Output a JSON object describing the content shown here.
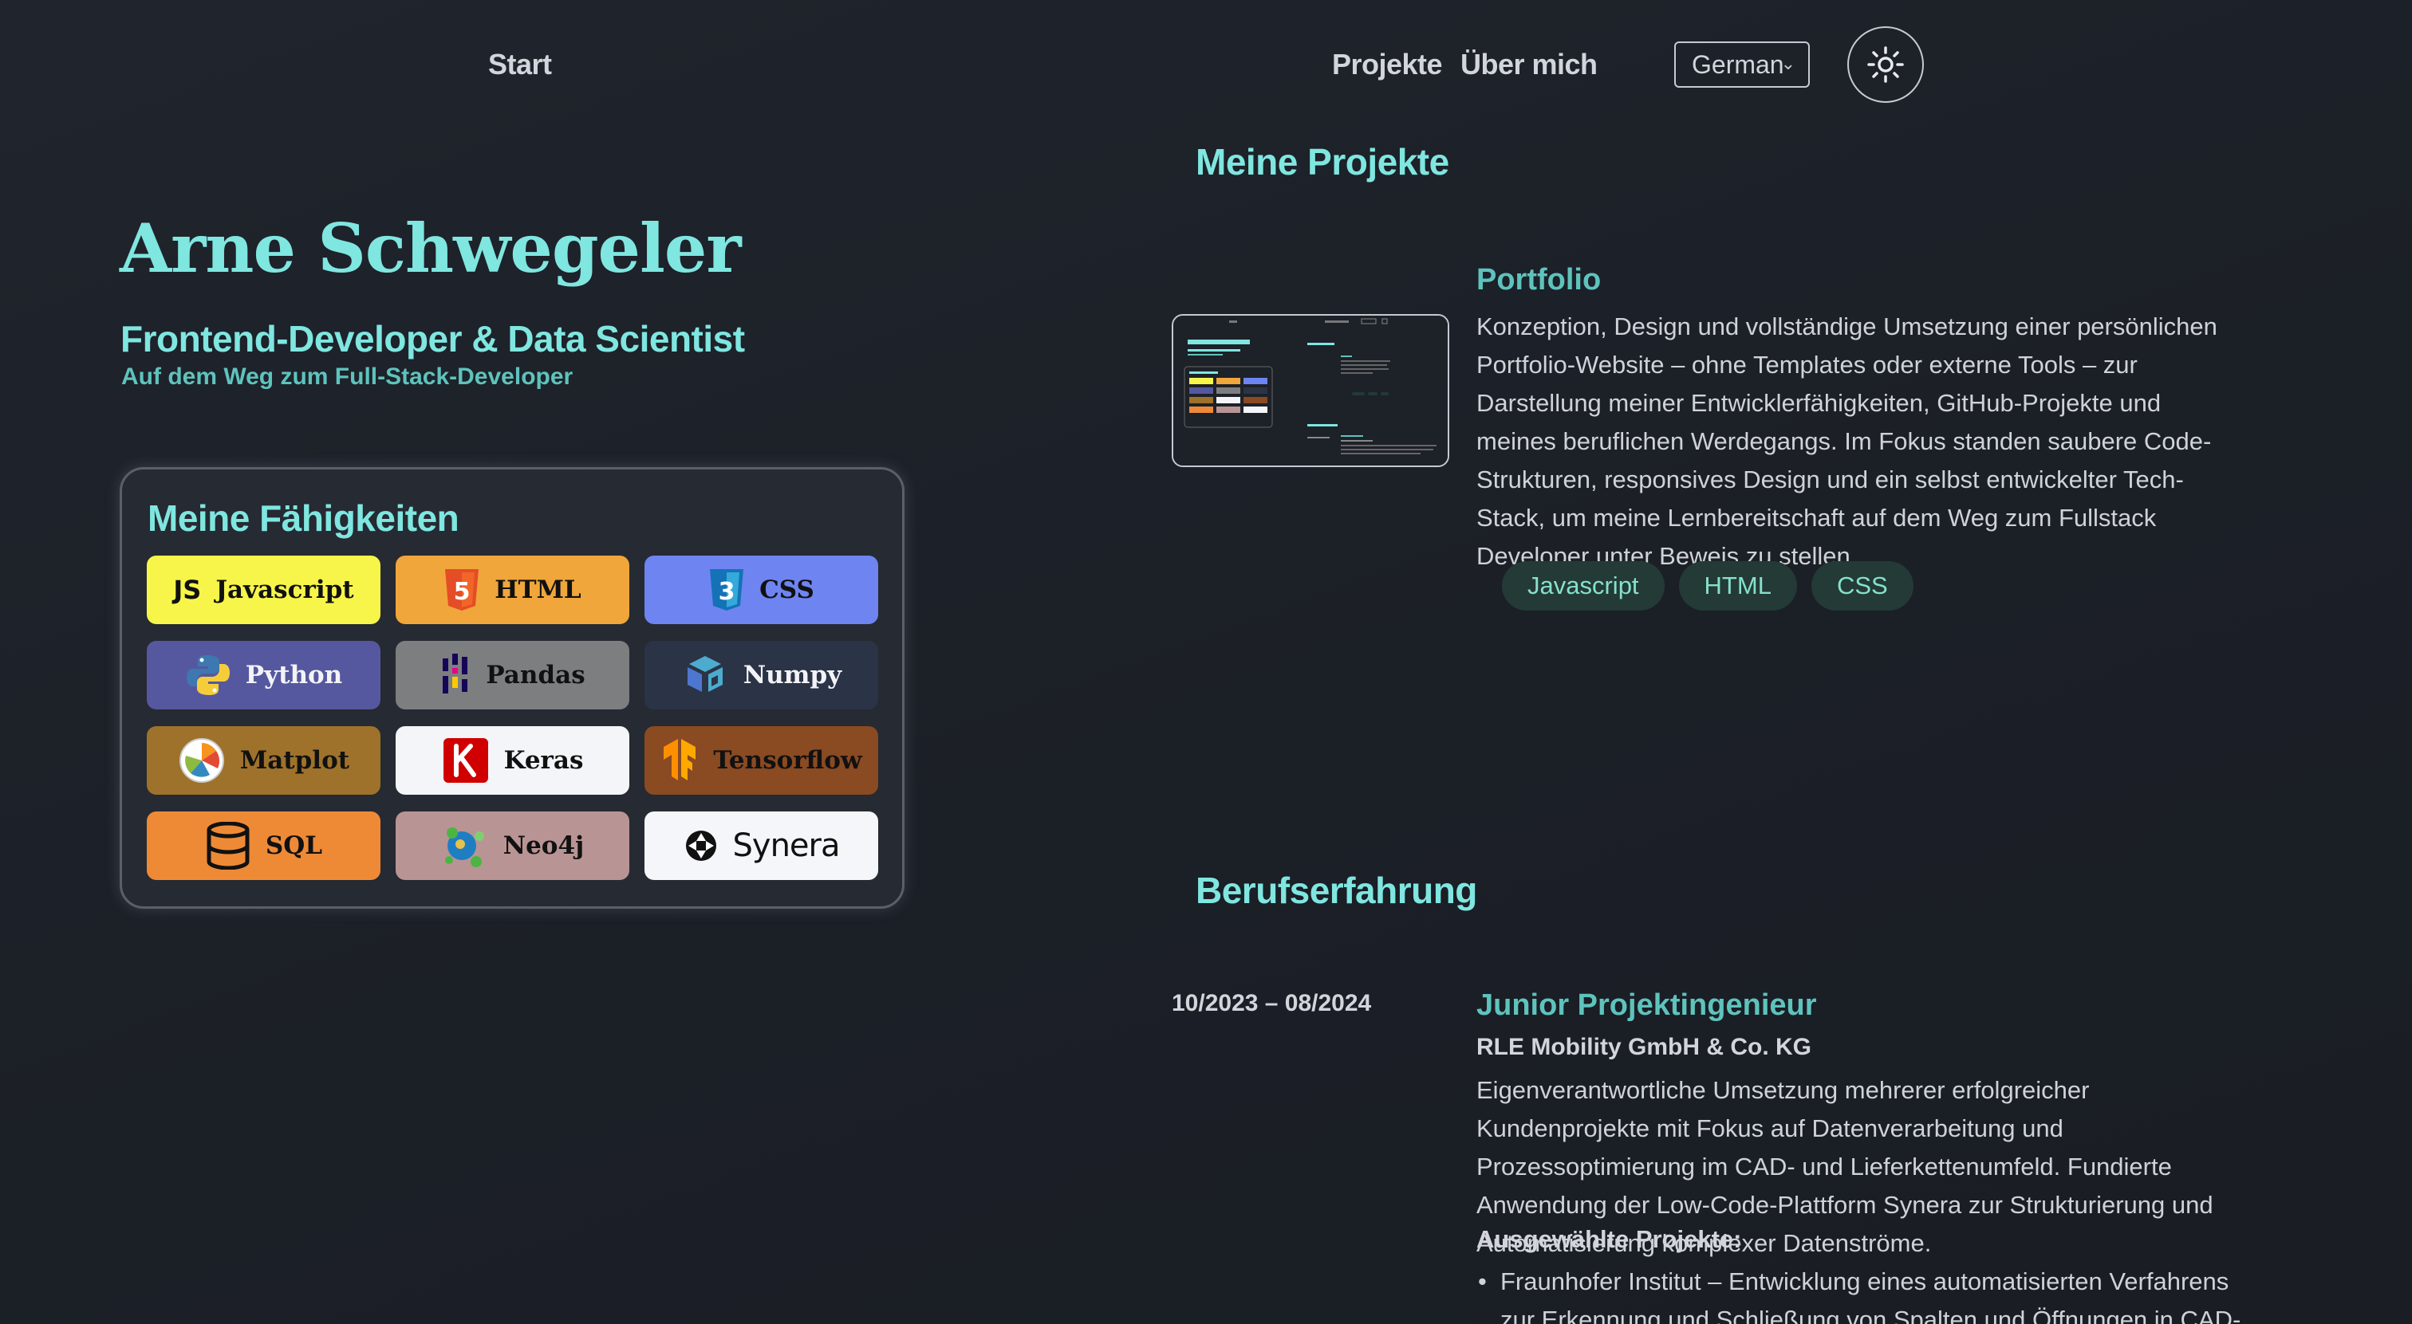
{
  "nav": {
    "start": "Start",
    "projects": "Projekte",
    "about": "Über mich",
    "language": "German",
    "theme_icon": "sun-icon"
  },
  "hero": {
    "name": "Arne Schwegeler",
    "role": "Frontend-Developer & Data Scientist",
    "subtitle": "Auf dem Weg zum Full-Stack-Developer"
  },
  "skills": {
    "title": "Meine Fähigkeiten",
    "items": [
      {
        "label": "Javascript",
        "icon": "javascript-icon",
        "bg": "#f7f54a"
      },
      {
        "label": "HTML",
        "icon": "html5-icon",
        "bg": "#f0a63a"
      },
      {
        "label": "CSS",
        "icon": "css3-icon",
        "bg": "#6e84f1"
      },
      {
        "label": "Python",
        "icon": "python-icon",
        "bg": "#55589f"
      },
      {
        "label": "Pandas",
        "icon": "pandas-icon",
        "bg": "#7d7e80"
      },
      {
        "label": "Numpy",
        "icon": "numpy-icon",
        "bg": "#2b3446"
      },
      {
        "label": "Matplot",
        "icon": "matplotlib-icon",
        "bg": "#9e722a"
      },
      {
        "label": "Keras",
        "icon": "keras-icon",
        "bg": "#f4f5f8"
      },
      {
        "label": "Tensorflow",
        "icon": "tensorflow-icon",
        "bg": "#8a4a22"
      },
      {
        "label": "SQL",
        "icon": "database-icon",
        "bg": "#ee8a36"
      },
      {
        "label": "Neo4j",
        "icon": "neo4j-icon",
        "bg": "#b99494"
      },
      {
        "label": "Synera",
        "icon": "synera-icon",
        "bg": "#f4f6fa"
      }
    ]
  },
  "projects": {
    "heading": "Meine Projekte",
    "items": [
      {
        "title": "Portfolio",
        "description": "Konzeption, Design und vollständige Umsetzung einer persönlichen Portfolio-Website – ohne Templates oder externe Tools – zur Darstellung meiner Entwicklerfähigkeiten, GitHub-Projekte und meines beruflichen Werdegangs. Im Fokus standen saubere Code-Strukturen, responsives Design und ein selbst entwickelter Tech-Stack, um meine Lernbereitschaft auf dem Weg zum Fullstack Developer unter Beweis zu stellen.",
        "tags": [
          "Javascript",
          "HTML",
          "CSS"
        ]
      }
    ]
  },
  "experience": {
    "heading": "Berufserfahrung",
    "items": [
      {
        "date": "10/2023 – 08/2024",
        "title": "Junior Projektingenieur",
        "company": "RLE Mobility GmbH & Co. KG",
        "description": "Eigenverantwortliche Umsetzung mehrerer erfolgreicher Kundenprojekte mit Fokus auf Datenverarbeitung und Prozessoptimierung im CAD- und Lieferkettenumfeld. Fundierte Anwendung der Low-Code-Plattform Synera zur Strukturierung und Automatisierung komplexer Datenströme.",
        "selected_label": "Ausgewählte Projekte:",
        "selected": [
          "Fraunhofer Institut – Entwicklung eines automatisierten Verfahrens zur Erkennung und Schließung von Spalten und Öffnungen in CAD-Modellen"
        ]
      }
    ]
  }
}
